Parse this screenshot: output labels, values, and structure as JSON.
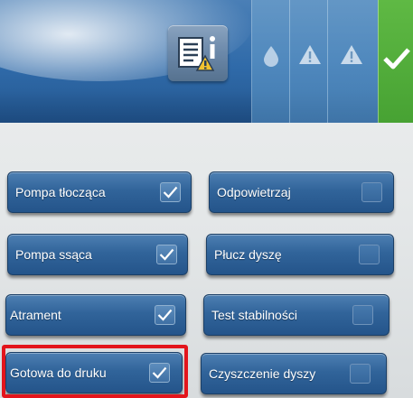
{
  "header": {
    "info_icon": "document-info-icon",
    "status_icons": [
      "ink-drop-icon",
      "warning-icon",
      "warning-icon",
      "checkmark-icon"
    ],
    "status_ok_color": "#4caf36"
  },
  "buttons": {
    "left": [
      {
        "label": "Pompa tłocząca",
        "checked": true
      },
      {
        "label": "Pompa ssąca",
        "checked": true
      },
      {
        "label": "Atrament",
        "checked": true
      },
      {
        "label": "Gotowa do druku",
        "checked": true
      }
    ],
    "right": [
      {
        "label": "Odpowietrzaj",
        "checked": false
      },
      {
        "label": "Płucz dyszę",
        "checked": false
      },
      {
        "label": "Test stabilności",
        "checked": false
      },
      {
        "label": "Czyszczenie dyszy",
        "checked": false
      }
    ]
  },
  "colors": {
    "button_blue": "#31649a",
    "highlight_red": "#e3151c"
  }
}
